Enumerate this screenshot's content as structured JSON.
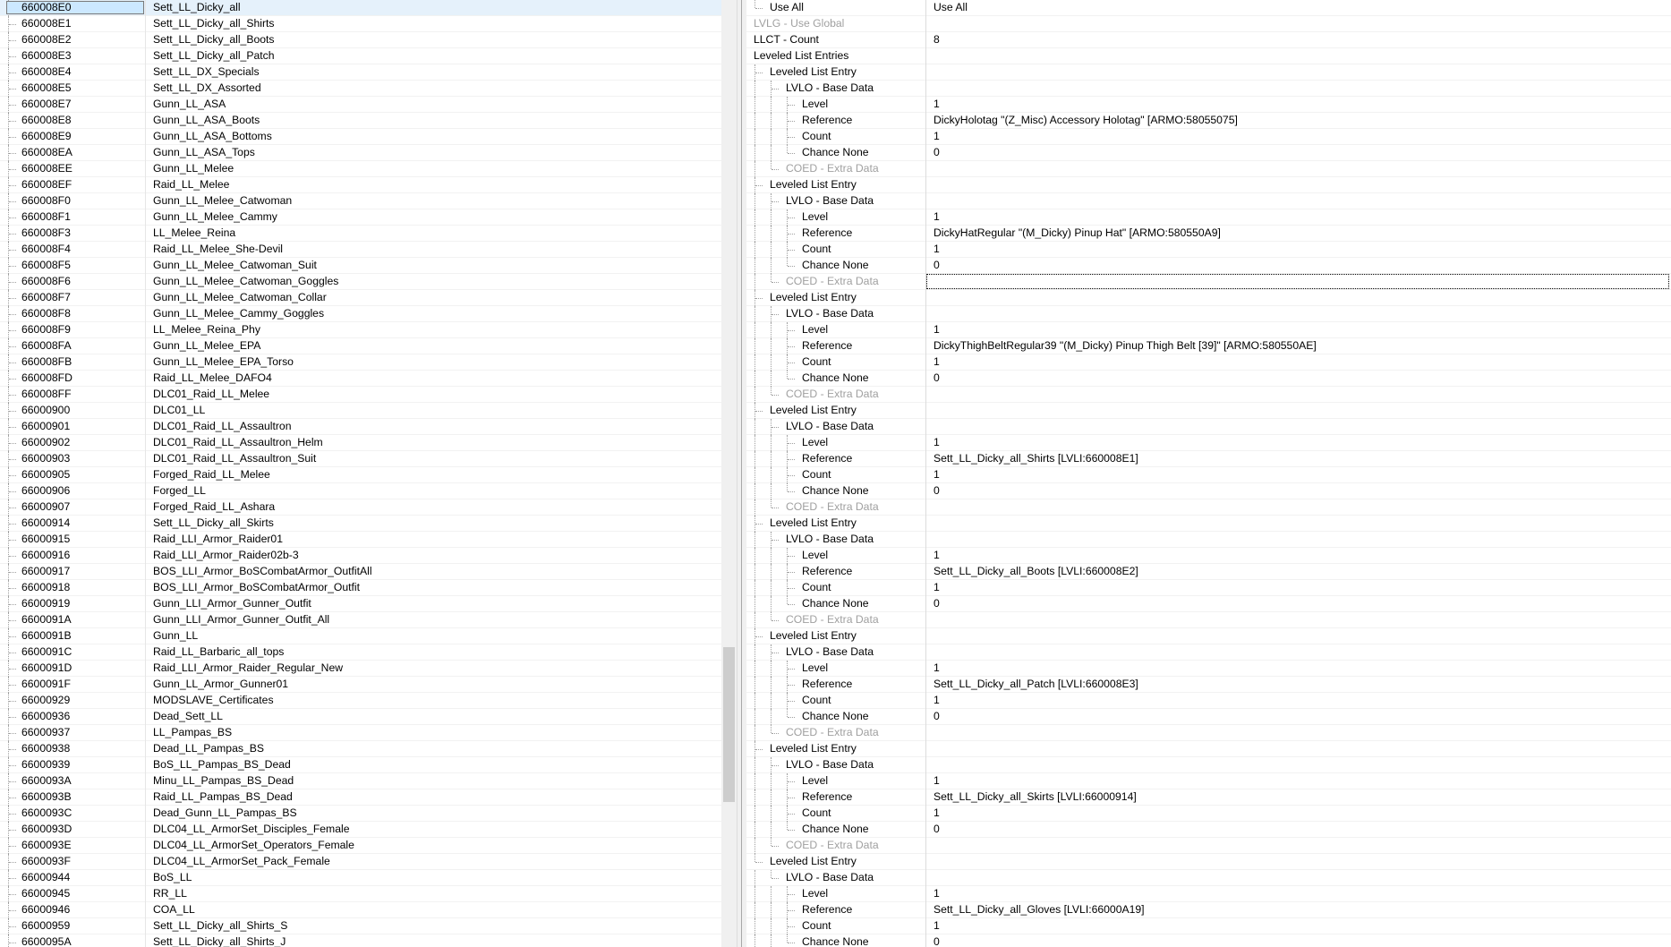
{
  "left_list": {
    "rows": [
      {
        "form_id": "660008E0",
        "editor_id": "Sett_LL_Dicky_all",
        "selected": true
      },
      {
        "form_id": "660008E1",
        "editor_id": "Sett_LL_Dicky_all_Shirts"
      },
      {
        "form_id": "660008E2",
        "editor_id": "Sett_LL_Dicky_all_Boots"
      },
      {
        "form_id": "660008E3",
        "editor_id": "Sett_LL_Dicky_all_Patch"
      },
      {
        "form_id": "660008E4",
        "editor_id": "Sett_LL_DX_Specials"
      },
      {
        "form_id": "660008E5",
        "editor_id": "Sett_LL_DX_Assorted"
      },
      {
        "form_id": "660008E7",
        "editor_id": "Gunn_LL_ASA"
      },
      {
        "form_id": "660008E8",
        "editor_id": "Gunn_LL_ASA_Boots"
      },
      {
        "form_id": "660008E9",
        "editor_id": "Gunn_LL_ASA_Bottoms"
      },
      {
        "form_id": "660008EA",
        "editor_id": "Gunn_LL_ASA_Tops"
      },
      {
        "form_id": "660008EE",
        "editor_id": "Gunn_LL_Melee"
      },
      {
        "form_id": "660008EF",
        "editor_id": "Raid_LL_Melee"
      },
      {
        "form_id": "660008F0",
        "editor_id": "Gunn_LL_Melee_Catwoman"
      },
      {
        "form_id": "660008F1",
        "editor_id": "Gunn_LL_Melee_Cammy"
      },
      {
        "form_id": "660008F3",
        "editor_id": "LL_Melee_Reina"
      },
      {
        "form_id": "660008F4",
        "editor_id": "Raid_LL_Melee_She-Devil"
      },
      {
        "form_id": "660008F5",
        "editor_id": "Gunn_LL_Melee_Catwoman_Suit"
      },
      {
        "form_id": "660008F6",
        "editor_id": "Gunn_LL_Melee_Catwoman_Goggles"
      },
      {
        "form_id": "660008F7",
        "editor_id": "Gunn_LL_Melee_Catwoman_Collar"
      },
      {
        "form_id": "660008F8",
        "editor_id": "Gunn_LL_Melee_Cammy_Goggles"
      },
      {
        "form_id": "660008F9",
        "editor_id": "LL_Melee_Reina_Phy"
      },
      {
        "form_id": "660008FA",
        "editor_id": "Gunn_LL_Melee_EPA"
      },
      {
        "form_id": "660008FB",
        "editor_id": "Gunn_LL_Melee_EPA_Torso"
      },
      {
        "form_id": "660008FD",
        "editor_id": "Raid_LL_Melee_DAFO4"
      },
      {
        "form_id": "660008FF",
        "editor_id": "DLC01_Raid_LL_Melee"
      },
      {
        "form_id": "66000900",
        "editor_id": "DLC01_LL"
      },
      {
        "form_id": "66000901",
        "editor_id": "DLC01_Raid_LL_Assaultron"
      },
      {
        "form_id": "66000902",
        "editor_id": "DLC01_Raid_LL_Assaultron_Helm"
      },
      {
        "form_id": "66000903",
        "editor_id": "DLC01_Raid_LL_Assaultron_Suit"
      },
      {
        "form_id": "66000905",
        "editor_id": "Forged_Raid_LL_Melee"
      },
      {
        "form_id": "66000906",
        "editor_id": "Forged_LL"
      },
      {
        "form_id": "66000907",
        "editor_id": "Forged_Raid_LL_Ashara"
      },
      {
        "form_id": "66000914",
        "editor_id": "Sett_LL_Dicky_all_Skirts"
      },
      {
        "form_id": "66000915",
        "editor_id": "Raid_LLI_Armor_Raider01"
      },
      {
        "form_id": "66000916",
        "editor_id": "Raid_LLI_Armor_Raider02b-3"
      },
      {
        "form_id": "66000917",
        "editor_id": "BOS_LLI_Armor_BoSCombatArmor_OutfitAll"
      },
      {
        "form_id": "66000918",
        "editor_id": "BOS_LLI_Armor_BoSCombatArmor_Outfit"
      },
      {
        "form_id": "66000919",
        "editor_id": "Gunn_LLI_Armor_Gunner_Outfit"
      },
      {
        "form_id": "6600091A",
        "editor_id": "Gunn_LLI_Armor_Gunner_Outfit_All"
      },
      {
        "form_id": "6600091B",
        "editor_id": "Gunn_LL"
      },
      {
        "form_id": "6600091C",
        "editor_id": "Raid_LL_Barbaric_all_tops"
      },
      {
        "form_id": "6600091D",
        "editor_id": "Raid_LLI_Armor_Raider_Regular_New"
      },
      {
        "form_id": "6600091F",
        "editor_id": "Gunn_LL_Armor_Gunner01"
      },
      {
        "form_id": "66000929",
        "editor_id": "MODSLAVE_Certificates"
      },
      {
        "form_id": "66000936",
        "editor_id": "Dead_Sett_LL"
      },
      {
        "form_id": "66000937",
        "editor_id": "LL_Pampas_BS"
      },
      {
        "form_id": "66000938",
        "editor_id": "Dead_LL_Pampas_BS"
      },
      {
        "form_id": "66000939",
        "editor_id": "BoS_LL_Pampas_BS_Dead"
      },
      {
        "form_id": "6600093A",
        "editor_id": "Minu_LL_Pampas_BS_Dead"
      },
      {
        "form_id": "6600093B",
        "editor_id": "Raid_LL_Pampas_BS_Dead"
      },
      {
        "form_id": "6600093C",
        "editor_id": "Dead_Gunn_LL_Pampas_BS"
      },
      {
        "form_id": "6600093D",
        "editor_id": "DLC04_LL_ArmorSet_Disciples_Female"
      },
      {
        "form_id": "6600093E",
        "editor_id": "DLC04_LL_ArmorSet_Operators_Female"
      },
      {
        "form_id": "6600093F",
        "editor_id": "DLC04_LL_ArmorSet_Pack_Female"
      },
      {
        "form_id": "66000944",
        "editor_id": "BoS_LL"
      },
      {
        "form_id": "66000945",
        "editor_id": "RR_LL"
      },
      {
        "form_id": "66000946",
        "editor_id": "COA_LL"
      },
      {
        "form_id": "66000959",
        "editor_id": "Sett_LL_Dicky_all_Shirts_S"
      },
      {
        "form_id": "6600095A",
        "editor_id": "Sett_LL_Dicky_all_Shirts_J"
      }
    ]
  },
  "right_tree": {
    "rows": [
      {
        "label": "Use All",
        "value": "Use All",
        "depth": 1
      },
      {
        "label": "LVLG - Use Global",
        "value": "",
        "depth": 0,
        "disabled": true
      },
      {
        "label": "LLCT - Count",
        "value": "8",
        "depth": 0
      },
      {
        "label": "Leveled List Entries",
        "value": "",
        "depth": 0
      },
      {
        "label": "Leveled List Entry",
        "value": "",
        "depth": 1
      },
      {
        "label": "LVLO - Base Data",
        "value": "",
        "depth": 2
      },
      {
        "label": "Level",
        "value": "1",
        "depth": 3
      },
      {
        "label": "Reference",
        "value": "DickyHolotag \"(Z_Misc) Accessory Holotag\" [ARMO:58055075]",
        "depth": 3
      },
      {
        "label": "Count",
        "value": "1",
        "depth": 3
      },
      {
        "label": "Chance None",
        "value": "0",
        "depth": 3
      },
      {
        "label": "COED - Extra Data",
        "value": "",
        "depth": 2,
        "disabled": true
      },
      {
        "label": "Leveled List Entry",
        "value": "",
        "depth": 1
      },
      {
        "label": "LVLO - Base Data",
        "value": "",
        "depth": 2
      },
      {
        "label": "Level",
        "value": "1",
        "depth": 3
      },
      {
        "label": "Reference",
        "value": "DickyHatRegular \"(M_Dicky) Pinup Hat\" [ARMO:580550A9]",
        "depth": 3
      },
      {
        "label": "Count",
        "value": "1",
        "depth": 3
      },
      {
        "label": "Chance None",
        "value": "0",
        "depth": 3
      },
      {
        "label": "COED - Extra Data",
        "value": "",
        "depth": 2,
        "disabled": true,
        "focused": true
      },
      {
        "label": "Leveled List Entry",
        "value": "",
        "depth": 1
      },
      {
        "label": "LVLO - Base Data",
        "value": "",
        "depth": 2
      },
      {
        "label": "Level",
        "value": "1",
        "depth": 3
      },
      {
        "label": "Reference",
        "value": "DickyThighBeltRegular39 \"(M_Dicky) Pinup Thigh Belt [39]\" [ARMO:580550AE]",
        "depth": 3
      },
      {
        "label": "Count",
        "value": "1",
        "depth": 3
      },
      {
        "label": "Chance None",
        "value": "0",
        "depth": 3
      },
      {
        "label": "COED - Extra Data",
        "value": "",
        "depth": 2,
        "disabled": true
      },
      {
        "label": "Leveled List Entry",
        "value": "",
        "depth": 1
      },
      {
        "label": "LVLO - Base Data",
        "value": "",
        "depth": 2
      },
      {
        "label": "Level",
        "value": "1",
        "depth": 3
      },
      {
        "label": "Reference",
        "value": "Sett_LL_Dicky_all_Shirts [LVLI:660008E1]",
        "depth": 3
      },
      {
        "label": "Count",
        "value": "1",
        "depth": 3
      },
      {
        "label": "Chance None",
        "value": "0",
        "depth": 3
      },
      {
        "label": "COED - Extra Data",
        "value": "",
        "depth": 2,
        "disabled": true
      },
      {
        "label": "Leveled List Entry",
        "value": "",
        "depth": 1
      },
      {
        "label": "LVLO - Base Data",
        "value": "",
        "depth": 2
      },
      {
        "label": "Level",
        "value": "1",
        "depth": 3
      },
      {
        "label": "Reference",
        "value": "Sett_LL_Dicky_all_Boots [LVLI:660008E2]",
        "depth": 3
      },
      {
        "label": "Count",
        "value": "1",
        "depth": 3
      },
      {
        "label": "Chance None",
        "value": "0",
        "depth": 3
      },
      {
        "label": "COED - Extra Data",
        "value": "",
        "depth": 2,
        "disabled": true
      },
      {
        "label": "Leveled List Entry",
        "value": "",
        "depth": 1
      },
      {
        "label": "LVLO - Base Data",
        "value": "",
        "depth": 2
      },
      {
        "label": "Level",
        "value": "1",
        "depth": 3
      },
      {
        "label": "Reference",
        "value": "Sett_LL_Dicky_all_Patch [LVLI:660008E3]",
        "depth": 3
      },
      {
        "label": "Count",
        "value": "1",
        "depth": 3
      },
      {
        "label": "Chance None",
        "value": "0",
        "depth": 3
      },
      {
        "label": "COED - Extra Data",
        "value": "",
        "depth": 2,
        "disabled": true
      },
      {
        "label": "Leveled List Entry",
        "value": "",
        "depth": 1
      },
      {
        "label": "LVLO - Base Data",
        "value": "",
        "depth": 2
      },
      {
        "label": "Level",
        "value": "1",
        "depth": 3
      },
      {
        "label": "Reference",
        "value": "Sett_LL_Dicky_all_Skirts [LVLI:66000914]",
        "depth": 3
      },
      {
        "label": "Count",
        "value": "1",
        "depth": 3
      },
      {
        "label": "Chance None",
        "value": "0",
        "depth": 3
      },
      {
        "label": "COED - Extra Data",
        "value": "",
        "depth": 2,
        "disabled": true
      },
      {
        "label": "Leveled List Entry",
        "value": "",
        "depth": 1
      },
      {
        "label": "LVLO - Base Data",
        "value": "",
        "depth": 2
      },
      {
        "label": "Level",
        "value": "1",
        "depth": 3
      },
      {
        "label": "Reference",
        "value": "Sett_LL_Dicky_all_Gloves [LVLI:66000A19]",
        "depth": 3
      },
      {
        "label": "Count",
        "value": "1",
        "depth": 3
      },
      {
        "label": "Chance None",
        "value": "0",
        "depth": 3
      }
    ]
  }
}
